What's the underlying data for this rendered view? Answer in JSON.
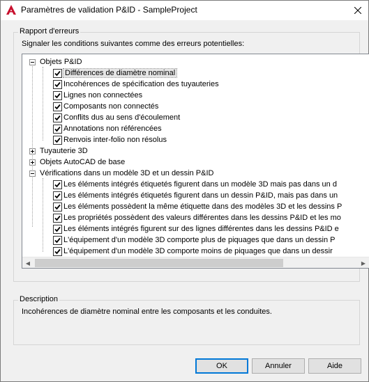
{
  "window": {
    "title": "Paramètres de validation P&ID - SampleProject",
    "close_glyph": "✕"
  },
  "report": {
    "group_label": "Rapport d'erreurs",
    "intro": "Signaler les conditions suivantes comme des erreurs potentielles:"
  },
  "tree": {
    "objets_pid": {
      "label": "Objets P&ID",
      "items": [
        "Différences de diamètre nominal",
        "Incohérences de spécification des tuyauteries",
        "Lignes non connectées",
        "Composants non connectés",
        "Conflits dus au sens d'écoulement",
        "Annotations non référencées",
        "Renvois inter-folio non résolus"
      ]
    },
    "tuyauterie_3d": {
      "label": "Tuyauterie 3D"
    },
    "objets_autocad": {
      "label": "Objets AutoCAD de base"
    },
    "verifications": {
      "label": "Vérifications dans un modèle 3D et un dessin P&ID",
      "items": [
        "Les éléments intégrés étiquetés figurent dans un modèle 3D mais pas dans un d",
        "Les éléments intégrés étiquetés figurent dans un dessin P&ID, mais pas dans un",
        "Les éléments possèdent la même étiquette dans des modèles 3D et les dessins P",
        "Les propriétés possèdent des valeurs différentes dans les dessins P&ID et les mo",
        "Les éléments intégrés figurent sur des lignes différentes dans les dessins P&ID e",
        "L'équipement d'un modèle 3D comporte plus de piquages que dans un dessin P",
        "L'équipement d'un modèle 3D comporte moins de piquages que dans un dessir"
      ]
    }
  },
  "description": {
    "group_label": "Description",
    "text": "Incohérences de diamètre nominal entre les composants et les conduites."
  },
  "buttons": {
    "ok": "OK",
    "cancel": "Annuler",
    "help": "Aide"
  },
  "colors": {
    "brand_red": "#c8102e",
    "default_button_border": "#0078d7"
  },
  "icons": {
    "app": "autocad-a-icon",
    "checkbox": "checkmark-icon",
    "expand": "plus-minus-box-icon"
  }
}
